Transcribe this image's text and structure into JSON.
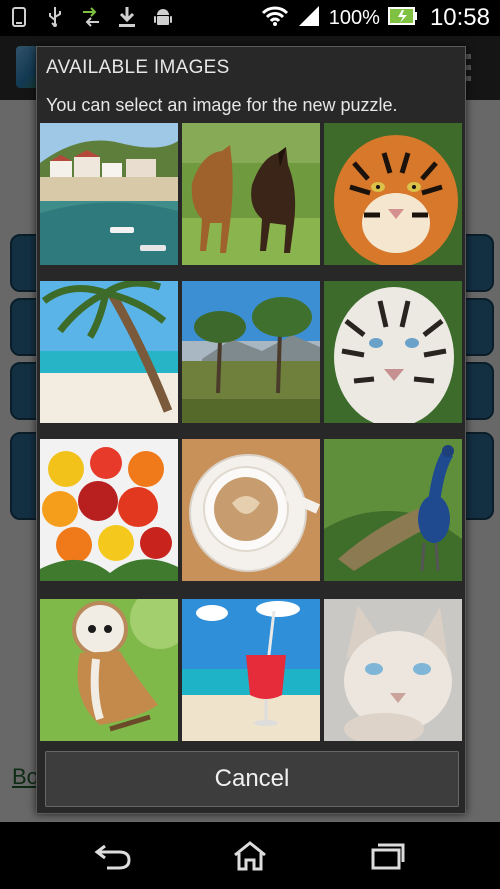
{
  "status_bar": {
    "icons_left": [
      "phone-icon",
      "usb-icon",
      "data-transfer-icon",
      "download-icon",
      "android-icon"
    ],
    "icons_right": [
      "wifi-icon",
      "signal-icon",
      "battery-icon"
    ],
    "battery": "100%",
    "time": "10:58"
  },
  "background_app": {
    "link_text": "Bo"
  },
  "dialog": {
    "title": "AVAILABLE IMAGES",
    "subtitle": "You can select an image for the new puzzle.",
    "images": [
      {
        "name": "harbor-town"
      },
      {
        "name": "horses"
      },
      {
        "name": "tiger"
      },
      {
        "name": "palm-beach"
      },
      {
        "name": "savanna-trees"
      },
      {
        "name": "white-tiger"
      },
      {
        "name": "roses-bouquet"
      },
      {
        "name": "coffee-cup"
      },
      {
        "name": "peacock"
      },
      {
        "name": "owl"
      },
      {
        "name": "beach-drink"
      },
      {
        "name": "siamese-cat"
      }
    ],
    "cancel_label": "Cancel"
  },
  "nav_bar": {
    "icons": [
      "back-icon",
      "home-icon",
      "recent-apps-icon"
    ]
  }
}
